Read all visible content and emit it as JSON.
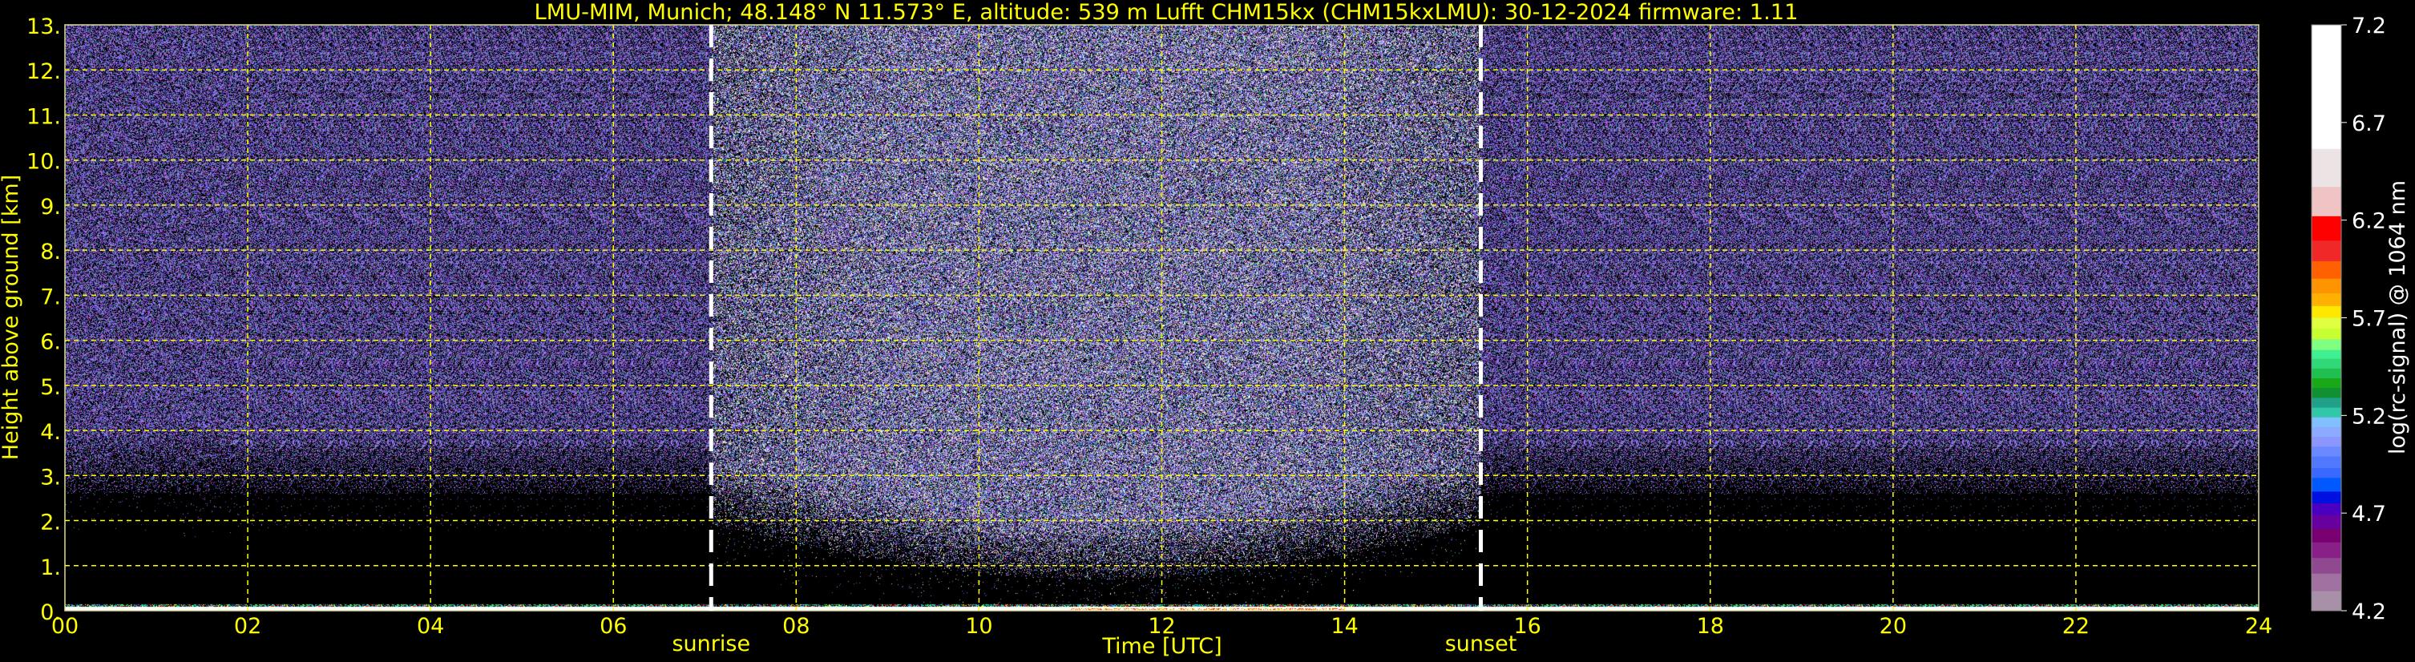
{
  "chart_data": {
    "type": "heatmap",
    "title": "LMU-MIM, Munich; 48.148° N 11.573° E, altitude: 539 m    Lufft CHM15kx (CHM15kxLMU): 30-12-2024    firmware: 1.11",
    "xlabel": "Time [UTC]",
    "ylabel": "Height above ground [km]",
    "xlim": [
      0,
      24
    ],
    "ylim": [
      0,
      13
    ],
    "x_ticks": [
      "00",
      "02",
      "04",
      "06",
      "08",
      "10",
      "12",
      "14",
      "16",
      "18",
      "20",
      "22",
      "24"
    ],
    "x_tick_values": [
      0,
      2,
      4,
      6,
      8,
      10,
      12,
      14,
      16,
      18,
      20,
      22,
      24
    ],
    "y_ticks": [
      "0.",
      "1.",
      "2.",
      "3.",
      "4.",
      "5.",
      "6.",
      "7.",
      "8.",
      "9.",
      "10.",
      "11.",
      "12.",
      "13."
    ],
    "y_tick_values": [
      0,
      1,
      2,
      3,
      4,
      5,
      6,
      7,
      8,
      9,
      10,
      11,
      12,
      13
    ],
    "grid": true,
    "grid_color": "#ffff00",
    "annotations": [
      {
        "label": "sunrise",
        "time_h": 7.07
      },
      {
        "label": "sunset",
        "time_h": 15.49
      }
    ],
    "surface_layer_top_km": 0.1,
    "colorbar": {
      "label": "log(rc-signal) @ 1064 nm",
      "range": [
        4.2,
        7.2
      ],
      "ticks": [
        "4.2",
        "4.7",
        "5.2",
        "5.7",
        "6.2",
        "6.7",
        "7.2"
      ],
      "tick_values": [
        4.2,
        4.7,
        5.2,
        5.7,
        6.2,
        6.7,
        7.2
      ],
      "bands": [
        {
          "from": 6.565,
          "to": 7.2,
          "color": "#ffffff"
        },
        {
          "from": 6.37,
          "to": 6.565,
          "color": "#ece4e4"
        },
        {
          "from": 6.22,
          "to": 6.37,
          "color": "#f0c4c4"
        },
        {
          "from": 6.095,
          "to": 6.22,
          "color": "#ff0000"
        },
        {
          "from": 5.99,
          "to": 6.095,
          "color": "#f02828"
        },
        {
          "from": 5.9,
          "to": 5.99,
          "color": "#ff6000"
        },
        {
          "from": 5.825,
          "to": 5.9,
          "color": "#ff9400"
        },
        {
          "from": 5.76,
          "to": 5.825,
          "color": "#ffb000"
        },
        {
          "from": 5.7,
          "to": 5.76,
          "color": "#ffe800"
        },
        {
          "from": 5.645,
          "to": 5.7,
          "color": "#e0ff40"
        },
        {
          "from": 5.59,
          "to": 5.645,
          "color": "#c8ff30"
        },
        {
          "from": 5.535,
          "to": 5.59,
          "color": "#80ff80"
        },
        {
          "from": 5.49,
          "to": 5.535,
          "color": "#40f090"
        },
        {
          "from": 5.44,
          "to": 5.49,
          "color": "#30d878"
        },
        {
          "from": 5.39,
          "to": 5.44,
          "color": "#20c050"
        },
        {
          "from": 5.34,
          "to": 5.39,
          "color": "#18a818"
        },
        {
          "from": 5.29,
          "to": 5.34,
          "color": "#109030"
        },
        {
          "from": 5.24,
          "to": 5.29,
          "color": "#20a088"
        },
        {
          "from": 5.19,
          "to": 5.24,
          "color": "#30c8a8"
        },
        {
          "from": 5.14,
          "to": 5.19,
          "color": "#80c0ff"
        },
        {
          "from": 5.09,
          "to": 5.14,
          "color": "#8caaff"
        },
        {
          "from": 5.04,
          "to": 5.09,
          "color": "#8c96ff"
        },
        {
          "from": 4.99,
          "to": 5.04,
          "color": "#6a88ff"
        },
        {
          "from": 4.93,
          "to": 4.99,
          "color": "#5078ff"
        },
        {
          "from": 4.88,
          "to": 4.93,
          "color": "#3868ff"
        },
        {
          "from": 4.81,
          "to": 4.88,
          "color": "#0058ff"
        },
        {
          "from": 4.75,
          "to": 4.81,
          "color": "#0010e0"
        },
        {
          "from": 4.69,
          "to": 4.75,
          "color": "#4a00c0"
        },
        {
          "from": 4.62,
          "to": 4.69,
          "color": "#6800a0"
        },
        {
          "from": 4.55,
          "to": 4.62,
          "color": "#780070"
        },
        {
          "from": 4.47,
          "to": 4.55,
          "color": "#882088"
        },
        {
          "from": 4.39,
          "to": 4.47,
          "color": "#904890"
        },
        {
          "from": 4.3,
          "to": 4.39,
          "color": "#a070a0"
        },
        {
          "from": 4.2,
          "to": 4.3,
          "color": "#a890a8"
        }
      ]
    }
  }
}
